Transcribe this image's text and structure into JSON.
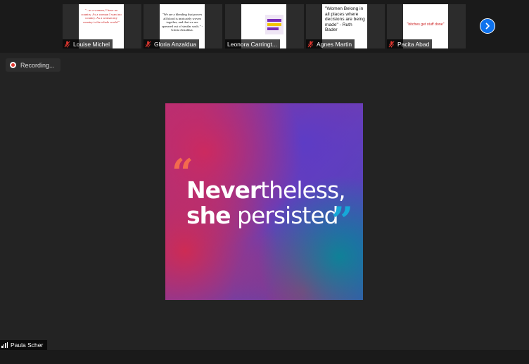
{
  "participants": [
    {
      "name": "Louise Michel",
      "quote": "\"...as a women, I have no country. As a woman I want no country. As a woman my country is the whole world.\"",
      "quote_color": "#cc2222"
    },
    {
      "name": "Gloria Anzaldua",
      "quote": "\"We are a blending that proves all blood is intricately woven together, and that we are spawned out of similar souls.\" -Gloria Anzaldua.",
      "quote_color": "#111111"
    },
    {
      "name": "Leonora Carringt...",
      "quote": "",
      "quote_color": "#333333"
    },
    {
      "name": "Agnes Martin",
      "quote": "\"Women Belong in all places where decisions are being made\" - Ruth Bader",
      "quote_color": "#111111"
    },
    {
      "name": "Pacita Abad",
      "quote": "\"bitches get stuff done\"",
      "quote_color": "#cc2222"
    }
  ],
  "recording": {
    "label": "Recording..."
  },
  "share": {
    "line1_a": "Never",
    "line1_b": "theless,",
    "line2_a": "she",
    "line2_b": "persisted",
    "open_quote": "“",
    "close_quote": "”"
  },
  "active_speaker": {
    "name": "Paula Scher"
  },
  "colors": {
    "accent": "#0e72ed",
    "record": "#e0372f",
    "mic_muted": "#e0372f"
  }
}
